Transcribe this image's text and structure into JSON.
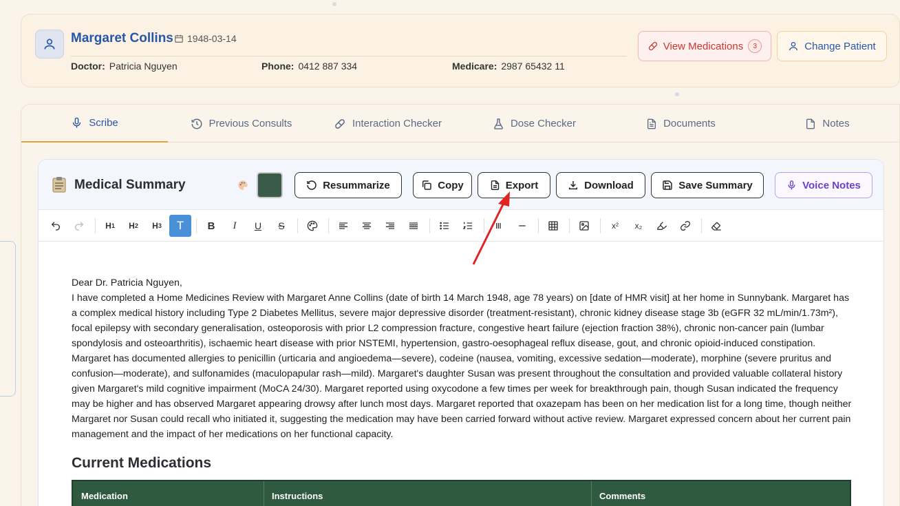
{
  "patient": {
    "name": "Margaret Collins",
    "dob": "1948-03-14",
    "doctor_label": "Doctor:",
    "doctor": "Patricia Nguyen",
    "phone_label": "Phone:",
    "phone": "0412 887 334",
    "medicare_label": "Medicare:",
    "medicare": "2987 65432 11"
  },
  "header_actions": {
    "view_medications": "View Medications",
    "medication_count": "3",
    "change_patient": "Change Patient"
  },
  "tabs": [
    {
      "label": "Scribe",
      "icon": "microphone-icon",
      "active": true
    },
    {
      "label": "Previous Consults",
      "icon": "history-icon"
    },
    {
      "label": "Interaction Checker",
      "icon": "pill-icon"
    },
    {
      "label": "Dose Checker",
      "icon": "flask-icon"
    },
    {
      "label": "Documents",
      "icon": "document-icon"
    },
    {
      "label": "Notes",
      "icon": "note-icon"
    }
  ],
  "summary": {
    "title": "Medical Summary",
    "swatch_color": "#3a5a4a",
    "buttons": {
      "resummarize": "Resummarize",
      "copy": "Copy",
      "export": "Export",
      "download": "Download",
      "save": "Save Summary",
      "voice": "Voice Notes"
    }
  },
  "toolbar": {
    "h1": "H",
    "h1_sub": "1",
    "h2": "H",
    "h2_sub": "2",
    "h3": "H",
    "h3_sub": "3",
    "text": "T",
    "bold": "B",
    "italic": "I",
    "underline": "U",
    "strike": "S",
    "superscript": "x²",
    "subscript": "x₂"
  },
  "document": {
    "salutation": "Dear Dr. Patricia Nguyen,",
    "body": "I have completed a Home Medicines Review with Margaret Anne Collins (date of birth 14 March 1948, age 78 years) on [date of HMR visit] at her home in Sunnybank. Margaret has a complex medical history including Type 2 Diabetes Mellitus, severe major depressive disorder (treatment-resistant), chronic kidney disease stage 3b (eGFR 32 mL/min/1.73m²), focal epilepsy with secondary generalisation, osteoporosis with prior L2 compression fracture, congestive heart failure (ejection fraction 38%), chronic non-cancer pain (lumbar spondylosis and osteoarthritis), ischaemic heart disease with prior NSTEMI, hypertension, gastro-oesophageal reflux disease, gout, and chronic opioid-induced constipation. Margaret has documented allergies to penicillin (urticaria and angioedema—severe), codeine (nausea, vomiting, excessive sedation—moderate), morphine (severe pruritus and confusion—moderate), and sulfonamides (maculopapular rash—mild). Margaret's daughter Susan was present throughout the consultation and provided valuable collateral history given Margaret's mild cognitive impairment (MoCA 24/30). Margaret reported using oxycodone a few times per week for breakthrough pain, though Susan indicated the frequency may be higher and has observed Margaret appearing drowsy after lunch most days. Margaret reported that oxazepam has been on her medication list for a long time, though neither Margaret nor Susan could recall who initiated it, suggesting the medication may have been carried forward without active review. Margaret expressed concern about her current pain management and the impact of her medications on her functional capacity.",
    "section_heading": "Current Medications",
    "table_headers": [
      "Medication",
      "Instructions",
      "Comments"
    ]
  },
  "colors": {
    "accent": "#2757a8",
    "alert": "#c8382f",
    "table_header": "#2f5a3f",
    "annotation_arrow": "#e02424"
  }
}
